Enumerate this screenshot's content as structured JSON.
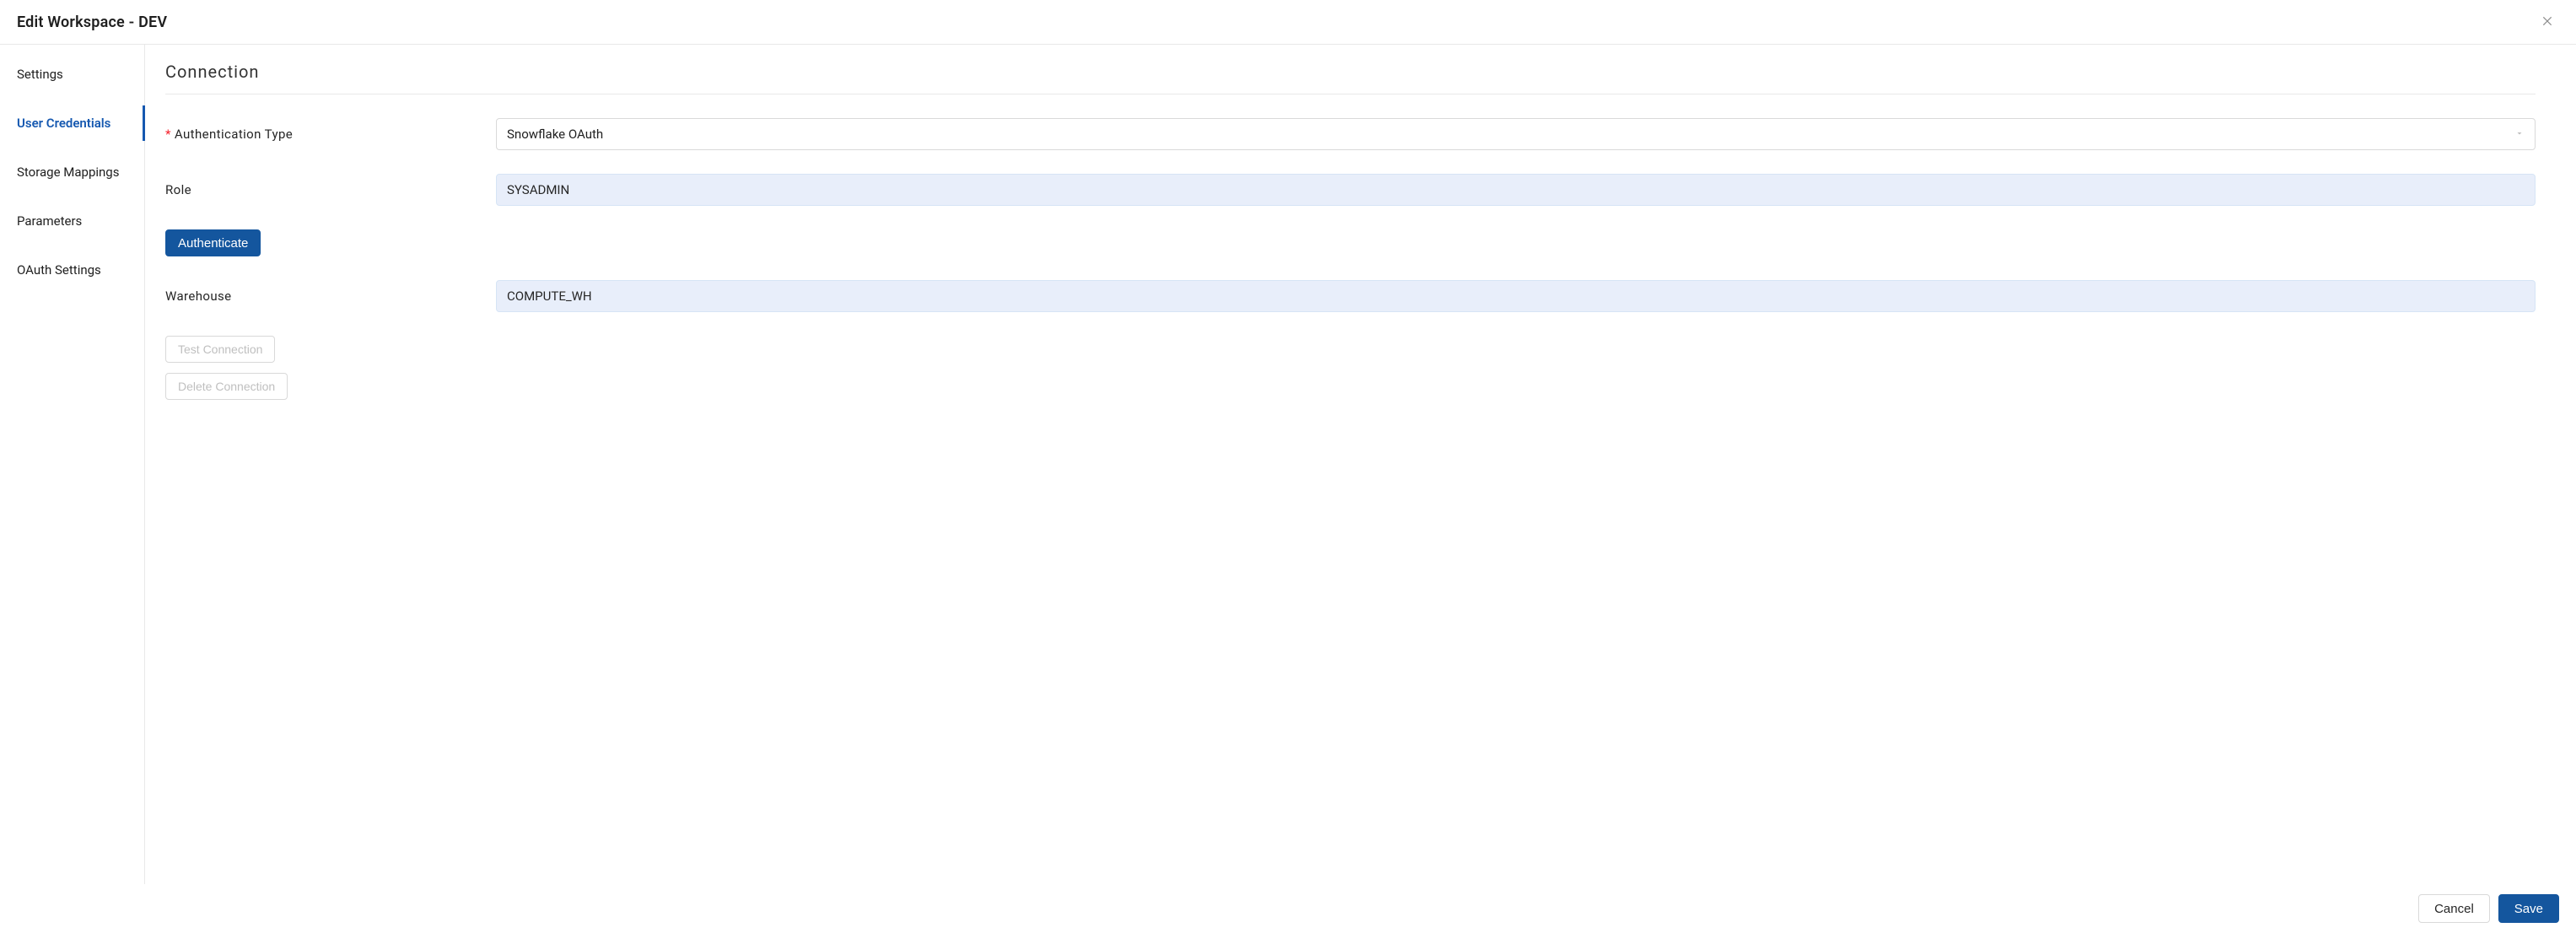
{
  "header": {
    "title": "Edit Workspace - DEV"
  },
  "sidebar": {
    "items": [
      {
        "label": "Settings"
      },
      {
        "label": "User Credentials"
      },
      {
        "label": "Storage Mappings"
      },
      {
        "label": "Parameters"
      },
      {
        "label": "OAuth Settings"
      }
    ],
    "active_index": 1
  },
  "content": {
    "section_title": "Connection",
    "fields": {
      "auth_type": {
        "label": "Authentication Type",
        "required": true,
        "value": "Snowflake OAuth"
      },
      "role": {
        "label": "Role",
        "value": "SYSADMIN"
      },
      "warehouse": {
        "label": "Warehouse",
        "value": "COMPUTE_WH"
      }
    },
    "buttons": {
      "authenticate": "Authenticate",
      "test_connection": "Test Connection",
      "delete_connection": "Delete Connection"
    }
  },
  "footer": {
    "cancel": "Cancel",
    "save": "Save"
  }
}
